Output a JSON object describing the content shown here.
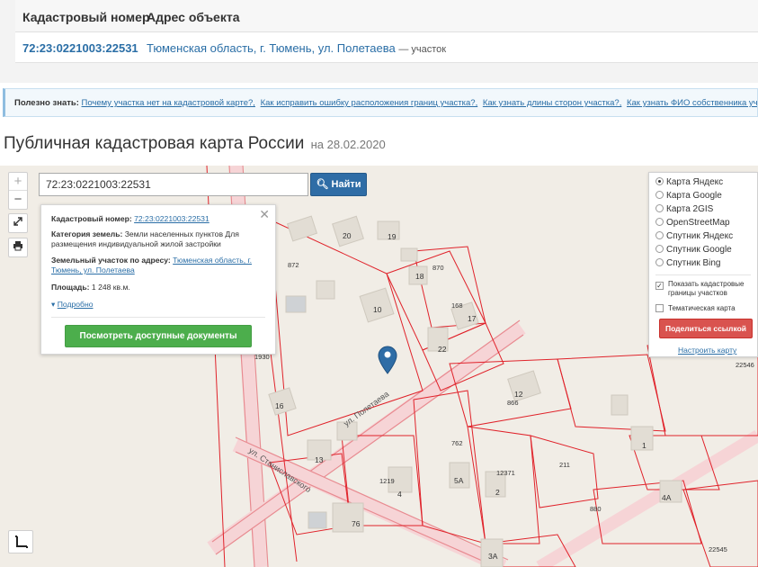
{
  "results": {
    "col_cadastral": "Кадастровый номер",
    "col_address": "Адрес объекта",
    "row": {
      "cadastral_number": "72:23:0221003:22531",
      "address": "Тюменская область, г. Тюмень, ул. Полетаева",
      "suffix": "— участок"
    }
  },
  "info": {
    "label": "Полезно знать:",
    "links": [
      "Почему участка нет на кадастровой карте?,",
      "Как исправить ошибку расположения границ участка?,",
      "Как узнать длины сторон участка?,",
      "Как узнать ФИО собственника участка?"
    ]
  },
  "title": {
    "main": "Публичная кадастровая карта России",
    "date": "на 28.02.2020"
  },
  "map": {
    "zoom_in": "+",
    "zoom_out": "−",
    "search_value": "72:23:0221003:22531",
    "search_button": "Найти",
    "popup": {
      "close": "✕",
      "cadastral_label": "Кадастровый номер:",
      "cadastral_value": "72:23:0221003:22531",
      "category_label": "Категория земель:",
      "category_value": "Земли населенных пунктов Для размещения индивидуальной жилой застройки",
      "address_label": "Земельный участок по адресу:",
      "address_value": "Тюменская область, г. Тюмень, ул. Полетаева",
      "area_label": "Площадь:",
      "area_value": "1 248 кв.м.",
      "more": "Подробно",
      "docs_button": "Посмотреть доступные документы"
    },
    "layers": {
      "options": [
        "Карта Яндекс",
        "Карта Google",
        "Карта 2GIS",
        "OpenStreetMap",
        "Спутник Яндекс",
        "Спутник Google",
        "Спутник Bing"
      ],
      "selected": "Карта Яндекс",
      "check_borders": "Показать кадастровые границы участков",
      "check_thematic": "Тематическая карта",
      "share_button": "Поделиться ссылкой",
      "setup_link": "Настроить карту"
    },
    "street_labels": [
      "ул. Полетаева",
      "ул. Станиславского"
    ],
    "house_numbers": [
      "20",
      "19",
      "18",
      "10",
      "17",
      "22",
      "12",
      "16",
      "1",
      "13",
      "2",
      "4",
      "5А",
      "76",
      "4А",
      "3А"
    ],
    "parcel_numbers": [
      "872",
      "870",
      "168",
      "866",
      "762",
      "1219",
      "12371",
      "211",
      "880",
      "22546",
      "22545",
      "1930",
      "870"
    ]
  },
  "colors": {
    "link": "#2a6ea6",
    "search_button": "#2f6da6",
    "docs_button": "#4cae4c",
    "share_button": "#d9534f",
    "parcel_border": "#e0222a",
    "road": "#f0a7ab"
  }
}
